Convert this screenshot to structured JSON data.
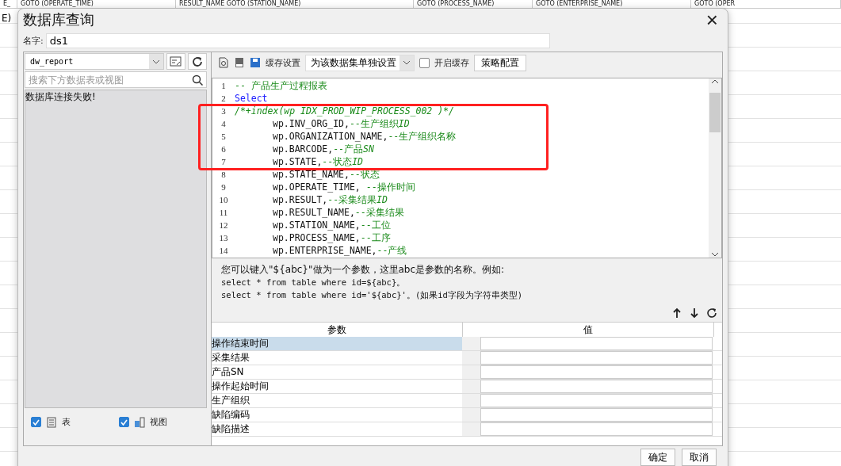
{
  "background_sheet": {
    "header_cells": [
      "E_",
      "GOTO (OPERATE_TIME)",
      "RESULT_NAME GOTO (STATION_NAME)",
      "GOTO (PROCESS_NAME)",
      "GOTO (ENTERPRISE_NAME)",
      "GOTO (OPER"
    ],
    "left_cell": "E)"
  },
  "window": {
    "title": "数据库查询",
    "close": "×"
  },
  "name_field": {
    "label": "名字:",
    "value": "ds1"
  },
  "left_panel": {
    "connection": "dw_report",
    "search": {
      "placeholder": "搜索下方数据表或视图"
    },
    "message": "数据库连接失败!",
    "filters": [
      {
        "label": "表",
        "checked": true,
        "kind": "table"
      },
      {
        "label": "视图",
        "checked": true,
        "kind": "view"
      }
    ]
  },
  "toolbar": {
    "cache_label": "缓存设置",
    "cache_mode": "为该数据集单独设置",
    "enable_cache": {
      "label": "开启缓存",
      "checked": false
    },
    "strategy_button": "策略配置"
  },
  "editor": {
    "lines": [
      {
        "number": "1",
        "indented": false,
        "parts": [
          {
            "kind": "comment",
            "text": "-- 产品生产过程报表"
          }
        ]
      },
      {
        "number": "2",
        "indented": false,
        "parts": [
          {
            "kind": "keyword",
            "text": "Select"
          }
        ]
      },
      {
        "number": "3",
        "indented": false,
        "parts": [
          {
            "kind": "hint",
            "text": "/*+index(wp IDX_PROD_WIP_PROCESS_002 )*/"
          }
        ]
      },
      {
        "number": "4",
        "indented": true,
        "parts": [
          {
            "kind": "code",
            "text": "wp.INV_ORG_ID,"
          },
          {
            "kind": "comment",
            "text": "--生产组织"
          },
          {
            "kind": "comment_italic",
            "text": "ID"
          }
        ]
      },
      {
        "number": "5",
        "indented": true,
        "parts": [
          {
            "kind": "code",
            "text": "wp.ORGANIZATION_NAME,"
          },
          {
            "kind": "comment",
            "text": "--生产组织名称"
          }
        ]
      },
      {
        "number": "6",
        "indented": true,
        "parts": [
          {
            "kind": "code",
            "text": "wp.BARCODE,"
          },
          {
            "kind": "comment",
            "text": "--产品"
          },
          {
            "kind": "comment_italic",
            "text": "SN"
          }
        ]
      },
      {
        "number": "7",
        "indented": true,
        "parts": [
          {
            "kind": "code",
            "text": "wp.STATE,"
          },
          {
            "kind": "comment",
            "text": "--状态"
          },
          {
            "kind": "comment_italic",
            "text": "ID"
          }
        ]
      },
      {
        "number": "8",
        "indented": true,
        "parts": [
          {
            "kind": "code",
            "text": "wp.STATE_NAME,"
          },
          {
            "kind": "comment",
            "text": "--状态"
          }
        ]
      },
      {
        "number": "9",
        "indented": true,
        "parts": [
          {
            "kind": "code",
            "text": "wp.OPERATE_TIME, "
          },
          {
            "kind": "comment",
            "text": "--操作时间"
          }
        ]
      },
      {
        "number": "10",
        "indented": true,
        "parts": [
          {
            "kind": "code",
            "text": "wp.RESULT,"
          },
          {
            "kind": "comment",
            "text": "--采集结果"
          },
          {
            "kind": "comment_italic",
            "text": "ID"
          }
        ]
      },
      {
        "number": "11",
        "indented": true,
        "parts": [
          {
            "kind": "code",
            "text": "wp.RESULT_NAME,"
          },
          {
            "kind": "comment",
            "text": "--采集结果"
          }
        ]
      },
      {
        "number": "12",
        "indented": true,
        "parts": [
          {
            "kind": "code",
            "text": "wp.STATION_NAME,"
          },
          {
            "kind": "comment",
            "text": "--工位"
          }
        ]
      },
      {
        "number": "13",
        "indented": true,
        "parts": [
          {
            "kind": "code",
            "text": "wp.PROCESS_NAME,"
          },
          {
            "kind": "comment",
            "text": "--工序"
          }
        ]
      },
      {
        "number": "14",
        "indented": true,
        "parts": [
          {
            "kind": "code",
            "text": "wp.ENTERPRISE_NAME,"
          },
          {
            "kind": "comment",
            "text": "--产线"
          }
        ]
      }
    ]
  },
  "hint": [
    "您可以键入\"${abc}\"做为一个参数，这里abc是参数的名称。例如:",
    "select * from table where id=${abc}。",
    "select * from table where id='${abc}'。(如果id字段为字符串类型)"
  ],
  "params": {
    "columns": [
      "参数",
      "值"
    ],
    "rows": [
      {
        "name": "操作结束时间",
        "selected": true
      },
      {
        "name": "采集结果",
        "selected": false
      },
      {
        "name": "产品SN",
        "selected": false
      },
      {
        "name": "操作起始时间",
        "selected": false
      },
      {
        "name": "生产组织",
        "selected": false
      },
      {
        "name": "缺陷编码",
        "selected": false
      },
      {
        "name": "缺陷描述",
        "selected": false
      }
    ]
  },
  "buttons": [
    "确定",
    "取消"
  ]
}
